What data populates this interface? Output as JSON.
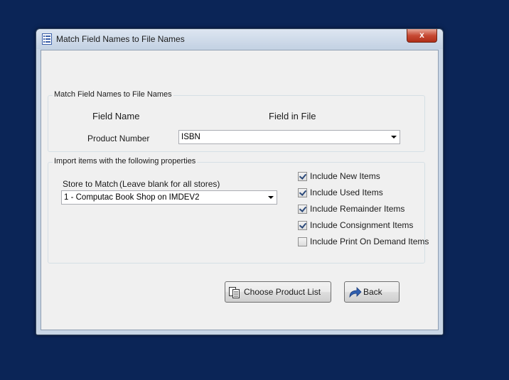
{
  "window": {
    "title": "Match Field Names to File Names",
    "close_glyph": "x",
    "title_icon": "list-icon"
  },
  "match_group": {
    "legend": "Match Field Names to File Names",
    "col_field_name": "Field Name",
    "col_field_in_file": "Field in File",
    "row_label": "Product Number",
    "row_value": "ISBN"
  },
  "import_group": {
    "legend": "Import items with the following properties",
    "store_label": "Store to Match",
    "store_hint": "(Leave blank for all stores)",
    "store_value": "1 - Computac Book Shop on IMDEV2",
    "checkboxes": [
      {
        "label": "Include New Items",
        "checked": true
      },
      {
        "label": "Include Used Items",
        "checked": true
      },
      {
        "label": "Include Remainder Items",
        "checked": true
      },
      {
        "label": "Include Consignment Items",
        "checked": true
      },
      {
        "label": "Include Print On Demand Items",
        "checked": false
      }
    ]
  },
  "buttons": {
    "choose_label": "Choose Product List",
    "choose_icon": "copy-list-icon",
    "back_label": "Back",
    "back_icon": "back-arrow-icon"
  }
}
